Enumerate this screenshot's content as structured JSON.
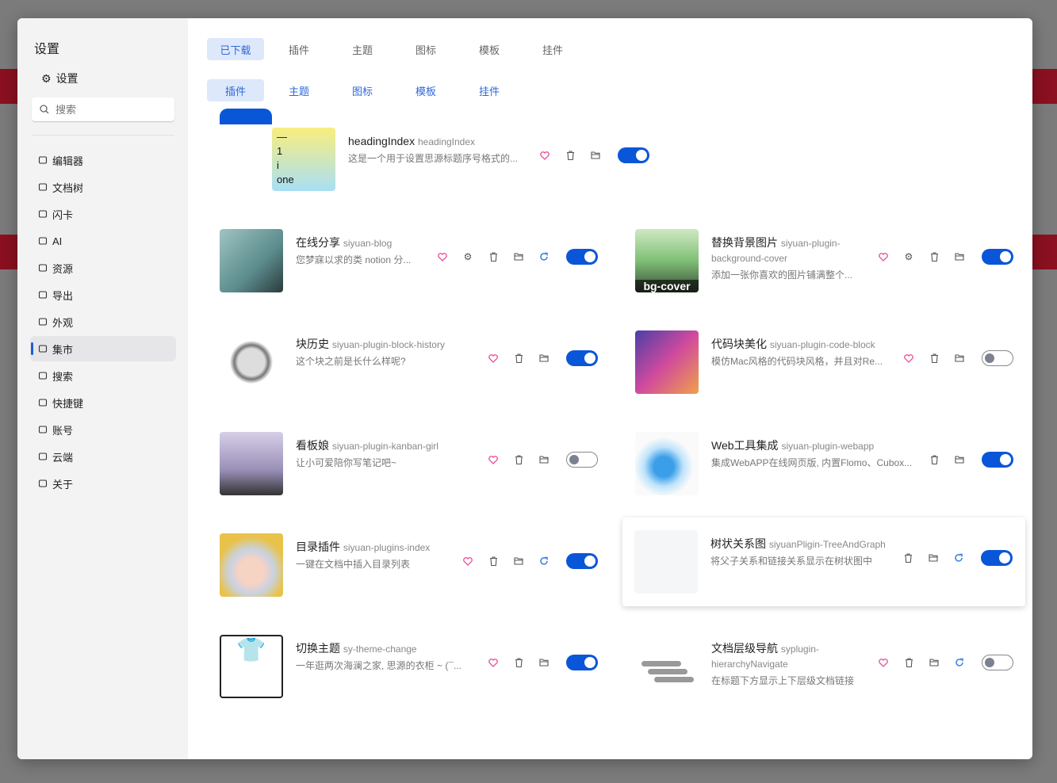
{
  "sidebar": {
    "title": "设置",
    "settings_label": "设置",
    "search_placeholder": "搜索",
    "items": [
      {
        "label": "编辑器",
        "icon": "pen-icon"
      },
      {
        "label": "文档树",
        "icon": "folder-icon"
      },
      {
        "label": "闪卡",
        "icon": "flashcard-icon"
      },
      {
        "label": "AI",
        "icon": "robot-icon"
      },
      {
        "label": "资源",
        "icon": "image-icon"
      },
      {
        "label": "导出",
        "icon": "upload-icon"
      },
      {
        "label": "外观",
        "icon": "palette-icon"
      },
      {
        "label": "集市",
        "icon": "bag-icon",
        "active": true
      },
      {
        "label": "搜索",
        "icon": "search-icon"
      },
      {
        "label": "快捷键",
        "icon": "keyboard-icon"
      },
      {
        "label": "账号",
        "icon": "account-icon"
      },
      {
        "label": "云端",
        "icon": "cloud-icon"
      },
      {
        "label": "关于",
        "icon": "info-icon"
      }
    ]
  },
  "tabs": [
    {
      "label": "已下载",
      "active": true
    },
    {
      "label": "插件"
    },
    {
      "label": "主题"
    },
    {
      "label": "图标"
    },
    {
      "label": "模板"
    },
    {
      "label": "挂件"
    }
  ],
  "subtabs": [
    {
      "label": "插件",
      "active": true
    },
    {
      "label": "主题"
    },
    {
      "label": "图标"
    },
    {
      "label": "模板"
    },
    {
      "label": "挂件"
    }
  ],
  "colors": {
    "accent": "#0a56d8",
    "heart": "#e8509a",
    "update": "#3b7ee8"
  },
  "plugins": [
    {
      "name": "headingIndex",
      "id": "headingIndex",
      "desc": "这是一个用于设置思源标题序号格式的...",
      "enabled": true,
      "actions": [
        "heart",
        "trash",
        "folder"
      ],
      "thumb_text": [
        "—",
        "1",
        "i",
        "one"
      ]
    },
    {
      "name": "在线分享",
      "id": "siyuan-blog",
      "desc": "您梦寐以求的类 notion 分...",
      "enabled": true,
      "actions": [
        "heart",
        "gear",
        "trash",
        "folder",
        "update"
      ]
    },
    {
      "name": "替换背景图片",
      "id": "siyuan-plugin-background-cover",
      "desc": "添加一张你喜欢的图片铺满整个...",
      "enabled": true,
      "actions": [
        "heart",
        "gear",
        "trash",
        "folder"
      ],
      "thumb_text": [
        "bg-cover"
      ]
    },
    {
      "name": "块历史",
      "id": "siyuan-plugin-block-history",
      "desc": "这个块之前是长什么样呢?",
      "enabled": true,
      "actions": [
        "heart",
        "trash",
        "folder"
      ]
    },
    {
      "name": "代码块美化",
      "id": "siyuan-plugin-code-block",
      "desc": "模仿Mac风格的代码块风格，并且对Re...",
      "enabled": false,
      "actions": [
        "heart",
        "trash",
        "folder"
      ]
    },
    {
      "name": "看板娘",
      "id": "siyuan-plugin-kanban-girl",
      "desc": "让小可爱陪你写笔记吧~",
      "enabled": false,
      "actions": [
        "heart",
        "trash",
        "folder"
      ]
    },
    {
      "name": "Web工具集成",
      "id": "siyuan-plugin-webapp",
      "desc": "集成WebAPP在线网页版, 内置Flomo、Cubox...",
      "enabled": true,
      "actions": [
        "trash",
        "folder"
      ]
    },
    {
      "name": "目录插件",
      "id": "siyuan-plugins-index",
      "desc": "一键在文档中插入目录列表",
      "enabled": true,
      "actions": [
        "heart",
        "trash",
        "folder",
        "update"
      ]
    },
    {
      "name": "树状关系图",
      "id": "siyuanPligin-TreeAndGraph",
      "desc": "将父子关系和链接关系显示在树状图中",
      "enabled": true,
      "actions": [
        "trash",
        "folder",
        "update"
      ]
    },
    {
      "name": "切换主题",
      "id": "sy-theme-change",
      "desc": "一年逛两次海澜之家, 思源的衣柜 ~ (¯...",
      "enabled": true,
      "actions": [
        "heart",
        "trash",
        "folder"
      ]
    },
    {
      "name": "文档层级导航",
      "id": "syplugin-hierarchyNavigate",
      "desc": "在标题下方显示上下层级文档链接",
      "enabled": false,
      "actions": [
        "heart",
        "trash",
        "folder",
        "update"
      ]
    }
  ]
}
